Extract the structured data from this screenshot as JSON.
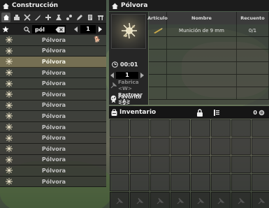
{
  "left_panel": {
    "title": "Construcción",
    "categories": [
      "home-icon",
      "hammer-icon",
      "tools-icon",
      "wrench-icon",
      "flask-icon",
      "chemistry-icon",
      "pencil-icon",
      "scroll-icon",
      "bench-icon"
    ],
    "search": {
      "value": "pól",
      "page": "1"
    },
    "recipes": [
      {
        "name": "Pólvora",
        "badge": "🐕"
      },
      {
        "name": "Pólvora"
      },
      {
        "name": "Pólvora"
      },
      {
        "name": "Pólvora"
      },
      {
        "name": "Pólvora"
      },
      {
        "name": "Pólvora"
      },
      {
        "name": "Pólvora"
      },
      {
        "name": "Pólvora"
      },
      {
        "name": "Pólvora"
      },
      {
        "name": "Pólvora"
      },
      {
        "name": "Pólvora"
      },
      {
        "name": "Pólvora"
      },
      {
        "name": "Pólvora"
      },
      {
        "name": "Pólvora"
      }
    ],
    "selected_index": 2
  },
  "detail_panel": {
    "title": "Pólvora",
    "craft_time": "00:01",
    "count": "1",
    "buttons": {
      "fabricar": "Fabrica <W>",
      "rastrear": "Rastrear <A>",
      "favorito": "Favorito <S>"
    },
    "table": {
      "headers": {
        "articulo": "Artículo",
        "nombre": "Nombre",
        "recuento": "Recuento"
      },
      "rows": [
        {
          "nombre": "Munición de 9 mm",
          "recuento": "0/1"
        }
      ]
    }
  },
  "inventory": {
    "title": "Inventario",
    "money": "0"
  }
}
